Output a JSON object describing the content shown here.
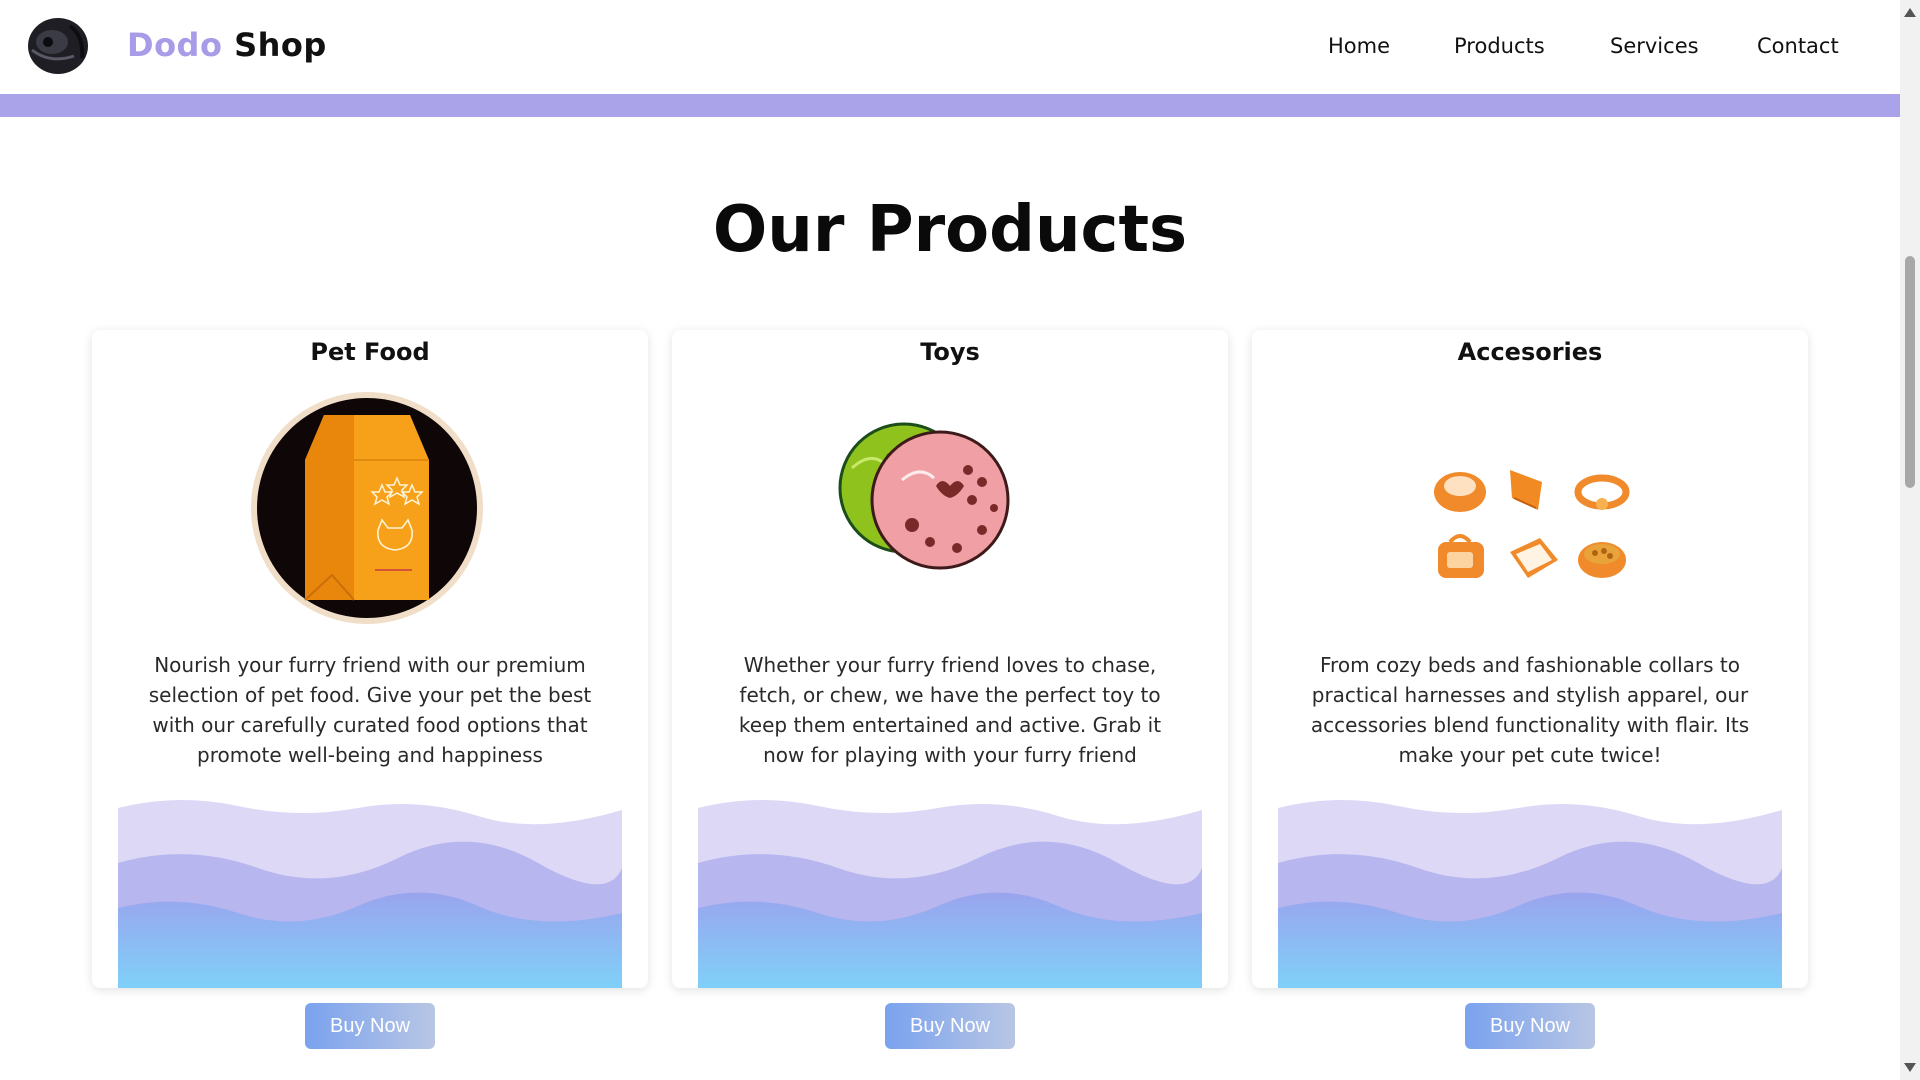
{
  "header": {
    "brand_part1": "Dodo",
    "brand_part2": "Shop",
    "nav": [
      "Home",
      "Products",
      "Services",
      "Contact"
    ]
  },
  "colors": {
    "accent": "#aaa3ea",
    "brand_purple": "#a89be8",
    "button_gradient_start": "#7aa2ee",
    "button_gradient_end": "#b8c6e4"
  },
  "main": {
    "title": "Our Products",
    "cards": [
      {
        "title": "Pet Food",
        "icon": "pet-food-bag-icon",
        "description": "Nourish your furry friend with our premium selection of pet food. Give your pet the best with our carefully curated food options that promote well-being and happiness",
        "button": "Buy Now"
      },
      {
        "title": "Toys",
        "icon": "toy-balls-icon",
        "description": "Whether your furry friend loves to chase, fetch, or chew, we have the perfect toy to keep them entertained and active. Grab it now for playing with your furry friend",
        "button": "Buy Now"
      },
      {
        "title": "Accesories",
        "icon": "pet-accessories-icon",
        "description": "From cozy beds and fashionable collars to practical harnesses and stylish apparel, our accessories blend functionality with flair. Its make your pet cute twice!",
        "button": "Buy Now"
      }
    ]
  }
}
